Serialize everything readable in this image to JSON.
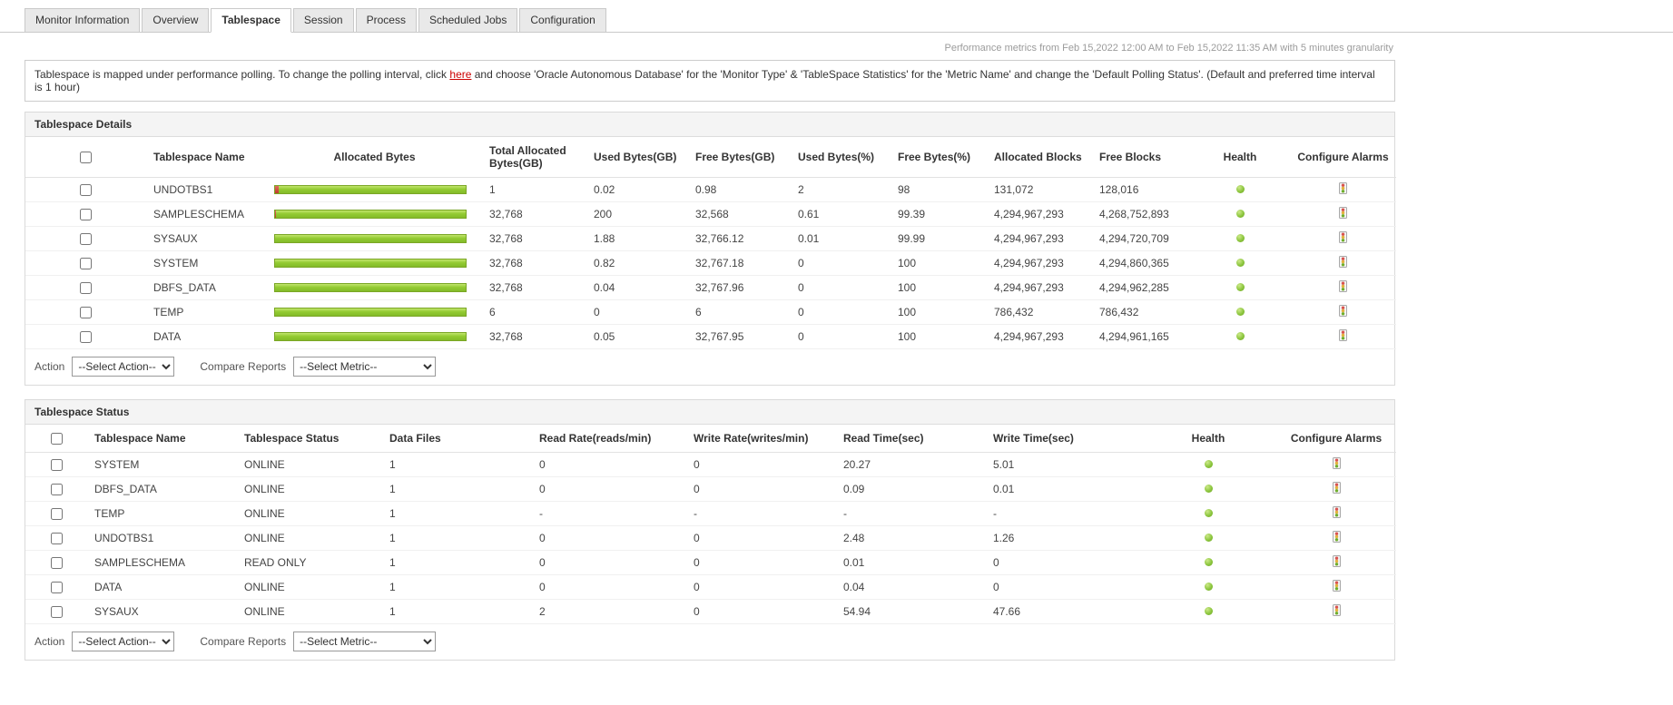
{
  "tabs": [
    {
      "label": "Monitor Information",
      "active": false
    },
    {
      "label": "Overview",
      "active": false
    },
    {
      "label": "Tablespace",
      "active": true
    },
    {
      "label": "Session",
      "active": false
    },
    {
      "label": "Process",
      "active": false
    },
    {
      "label": "Scheduled Jobs",
      "active": false
    },
    {
      "label": "Configuration",
      "active": false
    }
  ],
  "header": {
    "metrics_note": "Performance metrics from Feb 15,2022 12:00 AM to Feb 15,2022 11:35 AM with 5 minutes granularity"
  },
  "info_bar": {
    "text_before_link": "Tablespace is mapped under performance polling. To change the polling interval, click ",
    "link_text": "here",
    "text_after_link": " and choose 'Oracle Autonomous Database' for the 'Monitor Type' & 'TableSpace Statistics' for the 'Metric Name' and change the 'Default Polling Status'. (Default and preferred time interval is 1 hour)"
  },
  "tablespace_details": {
    "title": "Tablespace Details",
    "columns": [
      "Tablespace Name",
      "Allocated Bytes",
      "Total Allocated Bytes(GB)",
      "Used Bytes(GB)",
      "Free Bytes(GB)",
      "Used Bytes(%)",
      "Free Bytes(%)",
      "Allocated Blocks",
      "Free Blocks",
      "Health",
      "Configure Alarms"
    ],
    "rows": [
      {
        "name": "UNDOTBS1",
        "total": "1",
        "used": "0.02",
        "free": "0.98",
        "used_pct": "2",
        "free_pct": "98",
        "alloc_blocks": "131,072",
        "free_blocks": "128,016",
        "health": "green"
      },
      {
        "name": "SAMPLESCHEMA",
        "total": "32,768",
        "used": "200",
        "free": "32,568",
        "used_pct": "0.61",
        "free_pct": "99.39",
        "alloc_blocks": "4,294,967,293",
        "free_blocks": "4,268,752,893",
        "health": "green"
      },
      {
        "name": "SYSAUX",
        "total": "32,768",
        "used": "1.88",
        "free": "32,766.12",
        "used_pct": "0.01",
        "free_pct": "99.99",
        "alloc_blocks": "4,294,967,293",
        "free_blocks": "4,294,720,709",
        "health": "green"
      },
      {
        "name": "SYSTEM",
        "total": "32,768",
        "used": "0.82",
        "free": "32,767.18",
        "used_pct": "0",
        "free_pct": "100",
        "alloc_blocks": "4,294,967,293",
        "free_blocks": "4,294,860,365",
        "health": "green"
      },
      {
        "name": "DBFS_DATA",
        "total": "32,768",
        "used": "0.04",
        "free": "32,767.96",
        "used_pct": "0",
        "free_pct": "100",
        "alloc_blocks": "4,294,967,293",
        "free_blocks": "4,294,962,285",
        "health": "green"
      },
      {
        "name": "TEMP",
        "total": "6",
        "used": "0",
        "free": "6",
        "used_pct": "0",
        "free_pct": "100",
        "alloc_blocks": "786,432",
        "free_blocks": "786,432",
        "health": "green"
      },
      {
        "name": "DATA",
        "total": "32,768",
        "used": "0.05",
        "free": "32,767.95",
        "used_pct": "0",
        "free_pct": "100",
        "alloc_blocks": "4,294,967,293",
        "free_blocks": "4,294,961,165",
        "health": "green"
      }
    ],
    "action_label": "Action",
    "action_select_value": "--Select Action--",
    "compare_label": "Compare Reports",
    "compare_select_value": "--Select Metric--"
  },
  "tablespace_status": {
    "title": "Tablespace Status",
    "columns": [
      "Tablespace Name",
      "Tablespace Status",
      "Data Files",
      "Read Rate(reads/min)",
      "Write Rate(writes/min)",
      "Read Time(sec)",
      "Write Time(sec)",
      "Health",
      "Configure Alarms"
    ],
    "rows": [
      {
        "name": "SYSTEM",
        "status": "ONLINE",
        "data_files": "1",
        "read_rate": "0",
        "write_rate": "0",
        "read_time": "20.27",
        "write_time": "5.01",
        "health": "green"
      },
      {
        "name": "DBFS_DATA",
        "status": "ONLINE",
        "data_files": "1",
        "read_rate": "0",
        "write_rate": "0",
        "read_time": "0.09",
        "write_time": "0.01",
        "health": "green"
      },
      {
        "name": "TEMP",
        "status": "ONLINE",
        "data_files": "1",
        "read_rate": "-",
        "write_rate": "-",
        "read_time": "-",
        "write_time": "-",
        "health": "green"
      },
      {
        "name": "UNDOTBS1",
        "status": "ONLINE",
        "data_files": "1",
        "read_rate": "0",
        "write_rate": "0",
        "read_time": "2.48",
        "write_time": "1.26",
        "health": "green"
      },
      {
        "name": "SAMPLESCHEMA",
        "status": "READ ONLY",
        "data_files": "1",
        "read_rate": "0",
        "write_rate": "0",
        "read_time": "0.01",
        "write_time": "0",
        "health": "green"
      },
      {
        "name": "DATA",
        "status": "ONLINE",
        "data_files": "1",
        "read_rate": "0",
        "write_rate": "0",
        "read_time": "0.04",
        "write_time": "0",
        "health": "green"
      },
      {
        "name": "SYSAUX",
        "status": "ONLINE",
        "data_files": "1",
        "read_rate": "2",
        "write_rate": "0",
        "read_time": "54.94",
        "write_time": "47.66",
        "health": "green"
      }
    ],
    "action_label": "Action",
    "action_select_value": "--Select Action--",
    "compare_label": "Compare Reports",
    "compare_select_value": "--Select Metric--"
  }
}
